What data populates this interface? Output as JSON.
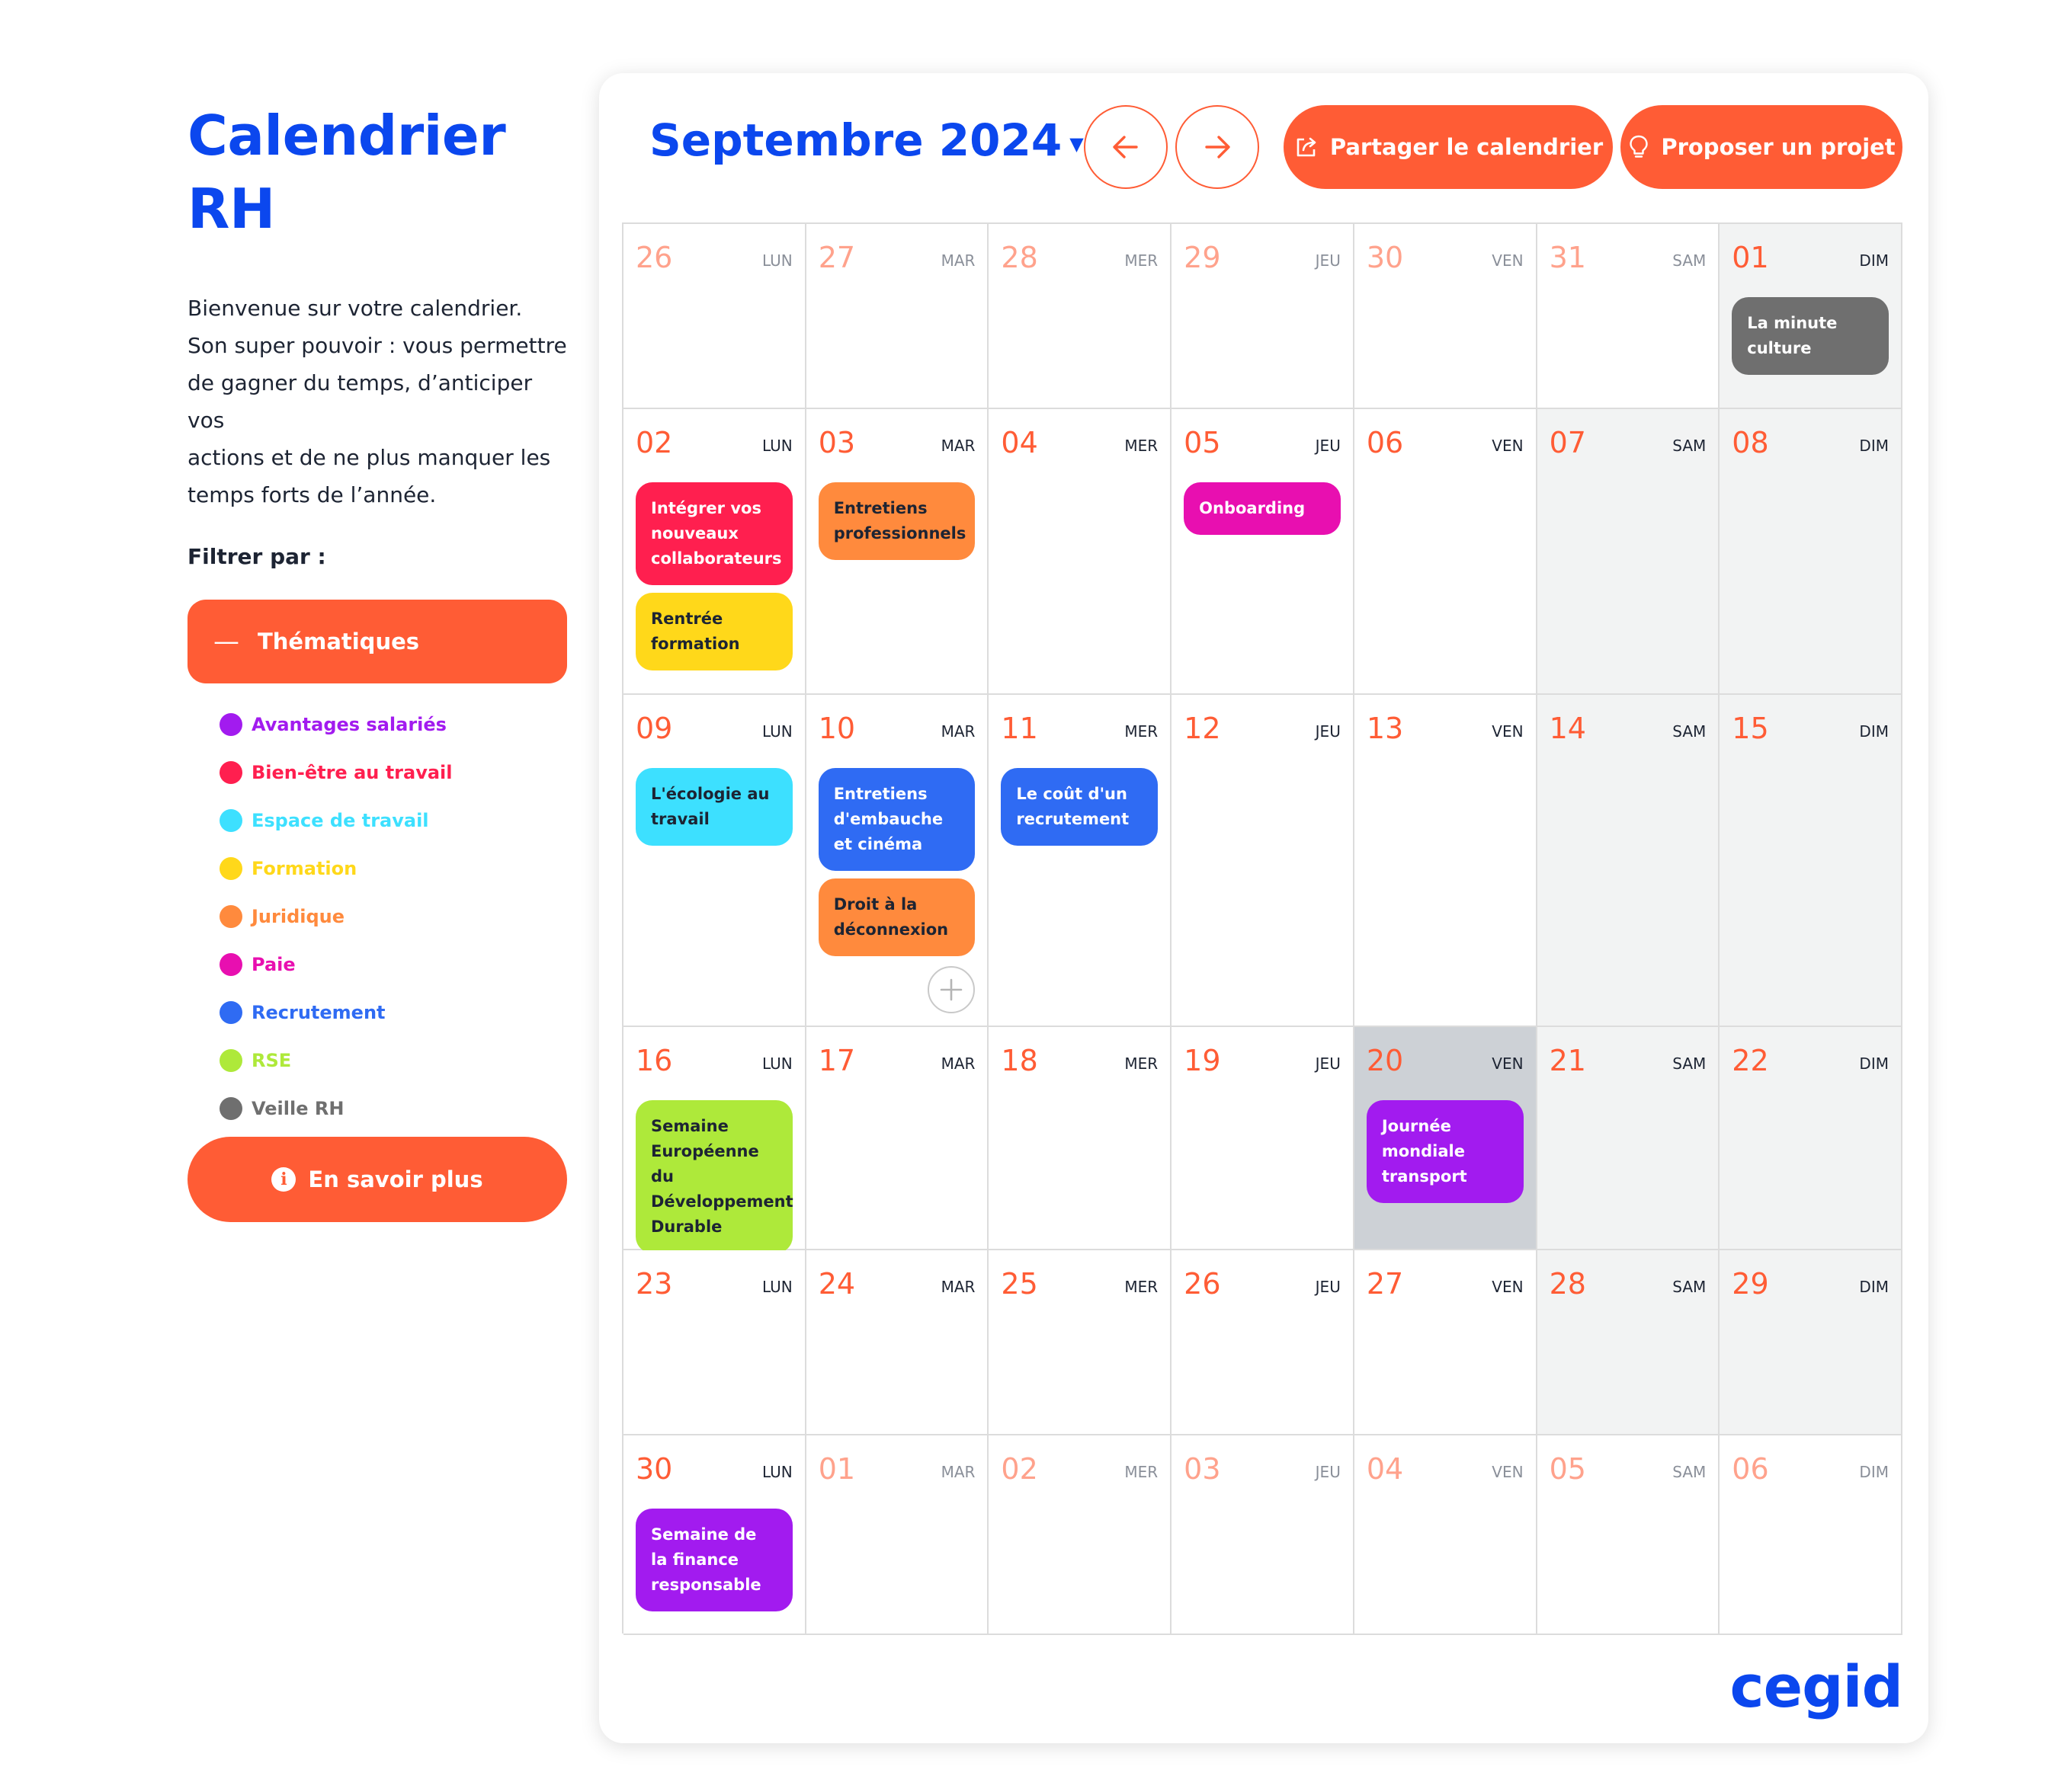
{
  "sidebar": {
    "title_line1": "Calendrier",
    "title_line2": "RH",
    "welcome": [
      "Bienvenue sur votre calendrier.",
      "Son super pouvoir : vous permettre",
      "de gagner du temps, d’anticiper vos",
      "actions et de ne plus manquer les",
      "temps forts de l’année."
    ],
    "filter_label": "Filtrer par :",
    "themes_button": "Thématiques",
    "legend": [
      {
        "label": "Avantages salariés",
        "color": "#a21bef"
      },
      {
        "label": "Bien-être au travail",
        "color": "#ff1f4f"
      },
      {
        "label": "Espace de travail",
        "color": "#3de0ff"
      },
      {
        "label": "Formation",
        "color": "#ffd81a"
      },
      {
        "label": "Juridique",
        "color": "#ff8a3d"
      },
      {
        "label": "Paie",
        "color": "#e80fb0"
      },
      {
        "label": "Recrutement",
        "color": "#2f6bf3"
      },
      {
        "label": "RSE",
        "color": "#aee93a"
      },
      {
        "label": "Veille RH",
        "color": "#6f6f6f"
      }
    ],
    "more_button": "En savoir plus"
  },
  "header": {
    "month": "Septembre 2024",
    "share_button": "Partager le calendrier",
    "propose_button": "Proposer un projet"
  },
  "colors": {
    "accent": "#ff5c35",
    "brand_blue": "#0b47ee"
  },
  "weeks": [
    [
      {
        "num": "26",
        "day": "LUN",
        "outside": true
      },
      {
        "num": "27",
        "day": "MAR",
        "outside": true
      },
      {
        "num": "28",
        "day": "MER",
        "outside": true
      },
      {
        "num": "29",
        "day": "JEU",
        "outside": true
      },
      {
        "num": "30",
        "day": "VEN",
        "outside": true
      },
      {
        "num": "31",
        "day": "SAM",
        "outside": true
      },
      {
        "num": "01",
        "day": "DIM",
        "weekend": true,
        "events": [
          {
            "label": "La minute culture",
            "theme": "Veille RH"
          }
        ]
      }
    ],
    [
      {
        "num": "02",
        "day": "LUN",
        "events": [
          {
            "label": "Intégrer vos nouveaux collaborateurs",
            "theme": "Bien-être au travail"
          },
          {
            "label": "Rentrée formation",
            "theme": "Formation"
          }
        ]
      },
      {
        "num": "03",
        "day": "MAR",
        "events": [
          {
            "label": "Entretiens professionnels",
            "theme": "Juridique"
          }
        ]
      },
      {
        "num": "04",
        "day": "MER"
      },
      {
        "num": "05",
        "day": "JEU",
        "events": [
          {
            "label": "Onboarding",
            "theme": "Paie"
          }
        ]
      },
      {
        "num": "06",
        "day": "VEN"
      },
      {
        "num": "07",
        "day": "SAM",
        "weekend": true
      },
      {
        "num": "08",
        "day": "DIM",
        "weekend": true
      }
    ],
    [
      {
        "num": "09",
        "day": "LUN",
        "events": [
          {
            "label": "L'écologie au travail",
            "theme": "Espace de travail"
          }
        ]
      },
      {
        "num": "10",
        "day": "MAR",
        "add": true,
        "events": [
          {
            "label": "Entretiens d'embauche et cinéma",
            "theme": "Recrutement"
          },
          {
            "label": "Droit à la déconnexion",
            "theme": "Juridique"
          }
        ]
      },
      {
        "num": "11",
        "day": "MER",
        "events": [
          {
            "label": "Le coût d'un recrutement",
            "theme": "Recrutement"
          }
        ]
      },
      {
        "num": "12",
        "day": "JEU"
      },
      {
        "num": "13",
        "day": "VEN"
      },
      {
        "num": "14",
        "day": "SAM",
        "weekend": true
      },
      {
        "num": "15",
        "day": "DIM",
        "weekend": true
      }
    ],
    [
      {
        "num": "16",
        "day": "LUN",
        "events": [
          {
            "label": "Semaine Européenne du Développement Durable",
            "theme": "RSE"
          }
        ]
      },
      {
        "num": "17",
        "day": "MAR"
      },
      {
        "num": "18",
        "day": "MER"
      },
      {
        "num": "19",
        "day": "JEU"
      },
      {
        "num": "20",
        "day": "VEN",
        "highlight": true,
        "events": [
          {
            "label": "Journée mondiale transport",
            "theme": "Avantages salariés"
          }
        ]
      },
      {
        "num": "21",
        "day": "SAM",
        "weekend": true
      },
      {
        "num": "22",
        "day": "DIM",
        "weekend": true
      }
    ],
    [
      {
        "num": "23",
        "day": "LUN"
      },
      {
        "num": "24",
        "day": "MAR"
      },
      {
        "num": "25",
        "day": "MER"
      },
      {
        "num": "26",
        "day": "JEU"
      },
      {
        "num": "27",
        "day": "VEN"
      },
      {
        "num": "28",
        "day": "SAM",
        "weekend": true
      },
      {
        "num": "29",
        "day": "DIM",
        "weekend": true
      }
    ],
    [
      {
        "num": "30",
        "day": "LUN",
        "events": [
          {
            "label": "Semaine de la finance responsable",
            "theme": "Avantages salariés"
          }
        ]
      },
      {
        "num": "01",
        "day": "MAR",
        "outside": true
      },
      {
        "num": "02",
        "day": "MER",
        "outside": true
      },
      {
        "num": "03",
        "day": "JEU",
        "outside": true
      },
      {
        "num": "04",
        "day": "VEN",
        "outside": true
      },
      {
        "num": "05",
        "day": "SAM",
        "outside": true
      },
      {
        "num": "06",
        "day": "DIM",
        "outside": true
      }
    ]
  ],
  "logo": "cegid"
}
